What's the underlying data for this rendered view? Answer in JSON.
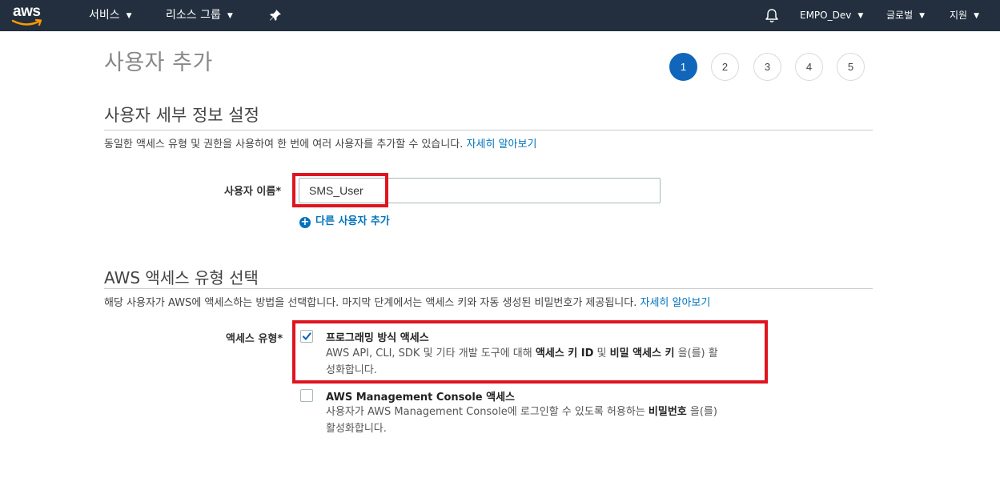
{
  "nav": {
    "logo_text": "aws",
    "services_label": "서비스",
    "resource_groups_label": "리소스 그룹",
    "account_label": "EMPO_Dev",
    "region_label": "글로벌",
    "support_label": "지원",
    "pin_icon": "pin-icon",
    "bell_icon": "bell-icon"
  },
  "page": {
    "title": "사용자 추가",
    "steps": [
      "1",
      "2",
      "3",
      "4",
      "5"
    ],
    "active_step": "1"
  },
  "user_details": {
    "heading": "사용자 세부 정보 설정",
    "description": "동일한 액세스 유형 및 권한을 사용하여 한 번에 여러 사용자를 추가할 수 있습니다.",
    "learn_more": "자세히 알아보기",
    "username_label": "사용자 이름*",
    "username_value": "SMS_User",
    "add_another_label": "다른 사용자 추가"
  },
  "access_type": {
    "heading": "AWS 액세스 유형 선택",
    "description": "해당 사용자가 AWS에 액세스하는 방법을 선택합니다. 마지막 단계에서는 액세스 키와 자동 생성된 비밀번호가 제공됩니다.",
    "learn_more": "자세히 알아보기",
    "label": "액세스 유형*",
    "programmatic": {
      "title": "프로그래밍 방식 액세스",
      "desc_1": "AWS API, CLI, SDK 및 기타 개발 도구에 대해 ",
      "desc_bold_1": "액세스 키 ID",
      "desc_2": " 및 ",
      "desc_bold_2": "비밀 액세스 키",
      "desc_3": " 을(를) 활",
      "desc_line2": "성화합니다.",
      "checked": true
    },
    "console": {
      "title": "AWS Management Console 액세스",
      "desc_1": "사용자가 AWS Management Console에 로그인할 수 있도록 허용하는 ",
      "desc_bold_1": "비밀번호",
      "desc_2": " 을(를)",
      "desc_line2": "활성화합니다.",
      "checked": false
    }
  },
  "colors": {
    "nav_bg": "#232f3e",
    "link": "#0073bb",
    "active_step": "#1166bb",
    "highlight": "#e0141e"
  }
}
